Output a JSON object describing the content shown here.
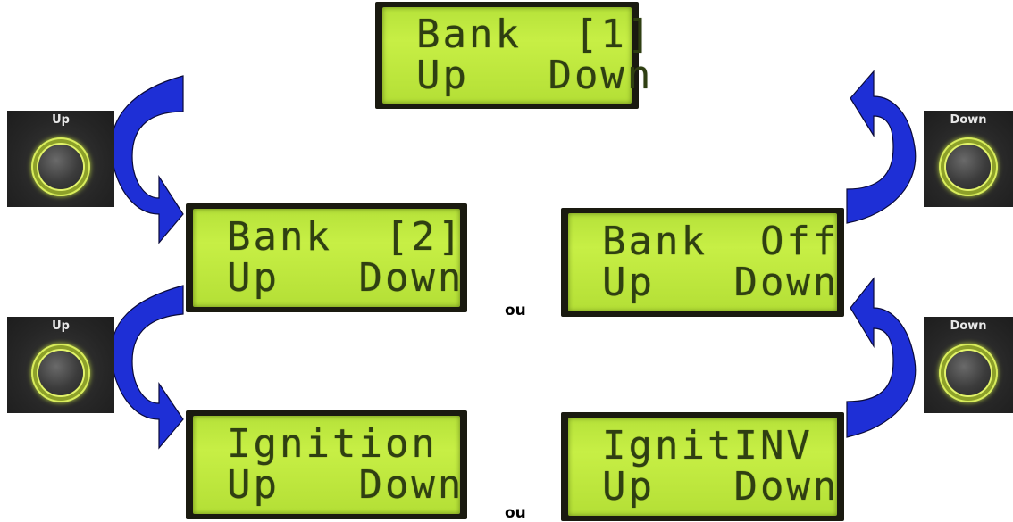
{
  "screens": {
    "bank1": {
      "line1": "Bank  [1]",
      "line2": "Up   Down"
    },
    "bank2": {
      "line1": "Bank  [2]",
      "line2": "Up   Down"
    },
    "bankoff": {
      "line1": "Bank  Off",
      "line2": "Up   Down"
    },
    "ignition": {
      "line1": "Ignition",
      "line2": "Up   Down"
    },
    "ignitinv": {
      "line1": "IgnitINV",
      "line2": "Up   Down"
    }
  },
  "buttons": {
    "up": {
      "label": "Up"
    },
    "down": {
      "label": "Down"
    }
  },
  "connector": {
    "or_label": "ou"
  },
  "colors": {
    "arrow": "#1e2fd6",
    "lcd_background": "#c0ea40",
    "lcd_text": "#2f3f12",
    "knob_ring": "#d8ec5c"
  }
}
